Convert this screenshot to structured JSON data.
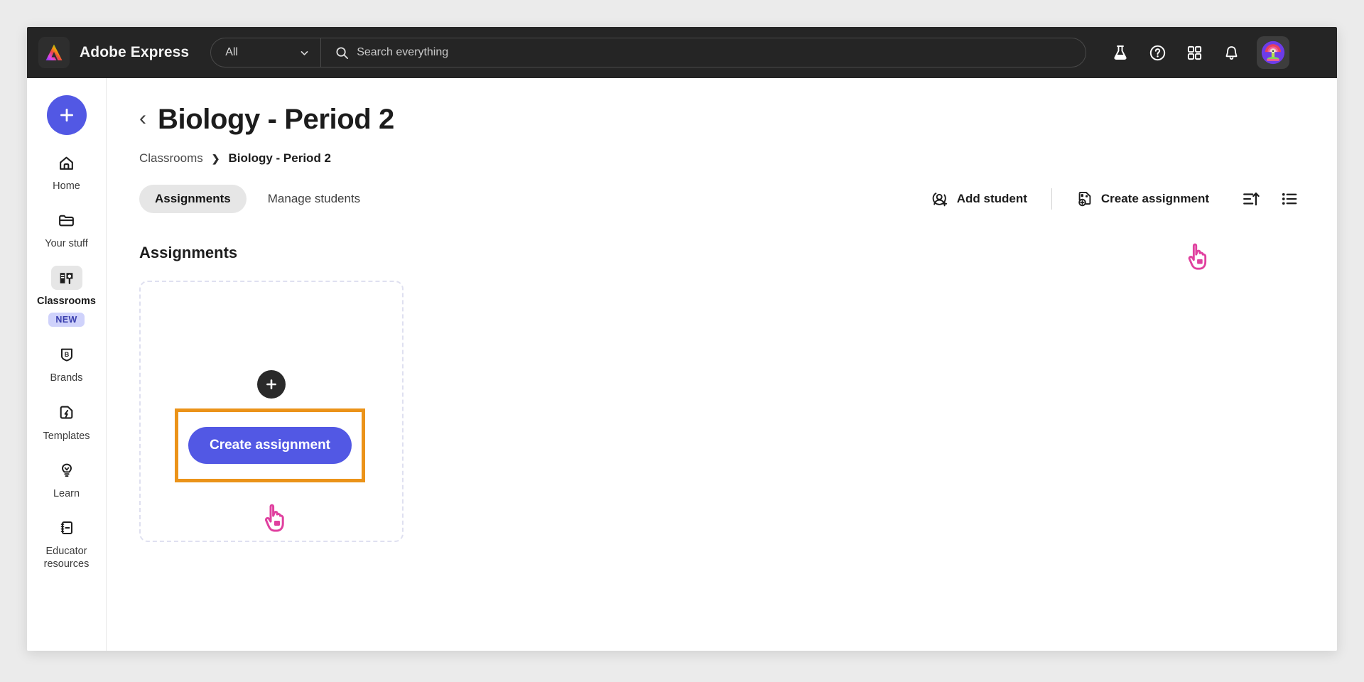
{
  "topbar": {
    "logo_icon": "adobe-express-logo",
    "brand": "Adobe Express",
    "search_scope": "All",
    "search_placeholder": "Search everything",
    "search_icon": "search-icon",
    "icons": [
      {
        "name": "beaker-icon",
        "label": "Experiments"
      },
      {
        "name": "help-icon",
        "label": "Help"
      },
      {
        "name": "apps-grid-icon",
        "label": "Apps"
      },
      {
        "name": "bell-icon",
        "label": "Notifications"
      }
    ],
    "avatar": "user-avatar"
  },
  "sidebar": {
    "new_button_label": "+",
    "items": [
      {
        "label": "Home",
        "icon": "home-icon",
        "active": false
      },
      {
        "label": "Your stuff",
        "icon": "folder-icon",
        "active": false
      },
      {
        "label": "Classrooms",
        "icon": "classrooms-icon",
        "active": true,
        "badge": "NEW"
      },
      {
        "label": "Brands",
        "icon": "brands-icon",
        "active": false
      },
      {
        "label": "Templates",
        "icon": "templates-icon",
        "active": false
      },
      {
        "label": "Learn",
        "icon": "lightbulb-icon",
        "active": false
      },
      {
        "label": "Educator resources",
        "icon": "notebook-icon",
        "active": false
      }
    ]
  },
  "page": {
    "back_label": "‹",
    "title": "Biology - Period 2",
    "breadcrumb": {
      "root": "Classrooms",
      "separator": "❯",
      "current": "Biology - Period 2"
    },
    "tabs": [
      {
        "label": "Assignments",
        "active": true
      },
      {
        "label": "Manage students",
        "active": false
      }
    ],
    "actions": {
      "add_student": "Add student",
      "add_student_icon": "add-person-icon",
      "create_assignment": "Create assignment",
      "create_assignment_icon": "add-document-icon",
      "sort_icon": "sort-ascending-icon",
      "list_view_icon": "list-view-icon"
    },
    "section_title": "Assignments",
    "empty_card": {
      "plus_icon": "plus-icon",
      "cta_label": "Create assignment"
    }
  },
  "colors": {
    "accent_blue": "#5258e4",
    "highlight_orange": "#eb9319",
    "cursor_pink": "#e0409f",
    "topbar_dark": "#252525",
    "badge_bg": "#cfd2fb",
    "badge_text": "#3a3fae"
  }
}
